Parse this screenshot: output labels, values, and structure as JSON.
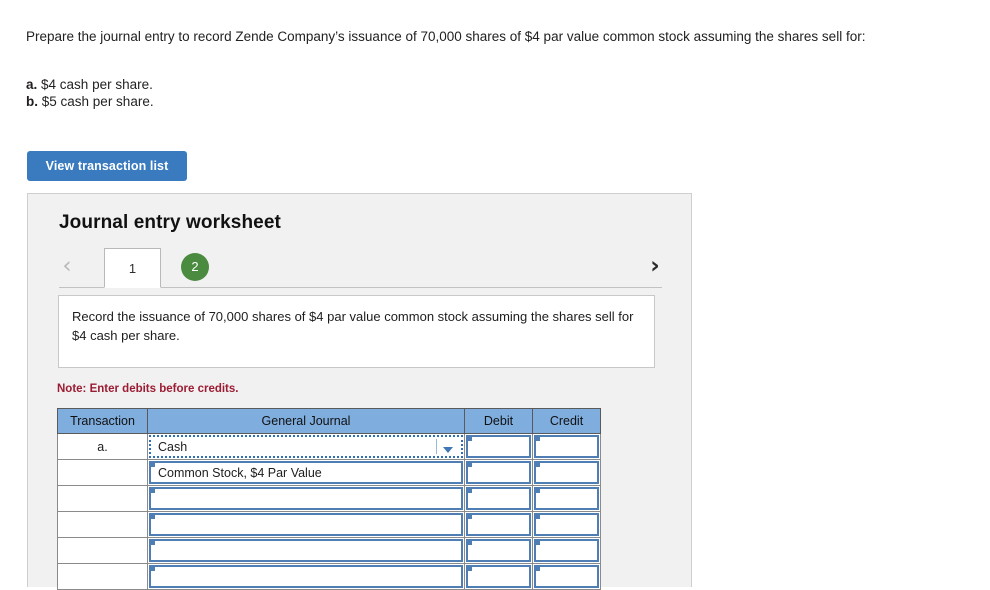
{
  "question": {
    "text": "Prepare the journal entry to record Zende Company’s issuance of 70,000 shares of $4 par value common stock assuming the shares sell for:",
    "choices": [
      {
        "label": "a.",
        "text": "$4 cash per share."
      },
      {
        "label": "b.",
        "text": "$5 cash per share."
      }
    ]
  },
  "toolbar": {
    "view_transaction_list_label": "View transaction list"
  },
  "worksheet": {
    "title": "Journal entry worksheet",
    "prev_arrow": "‹",
    "next_arrow": "›",
    "tabs": [
      {
        "label": "1",
        "state": "active"
      },
      {
        "label": "2",
        "state": "completed"
      }
    ],
    "instruction": "Record the issuance of 70,000 shares of $4 par value common stock assuming the shares sell for $4 cash per share.",
    "note": "Note: Enter debits before credits.",
    "table": {
      "columns": [
        "Transaction",
        "General Journal",
        "Debit",
        "Credit"
      ],
      "rows": [
        {
          "transaction": "a.",
          "general_journal": "Cash",
          "debit": "",
          "credit": "",
          "selected": true,
          "dropdown": true
        },
        {
          "transaction": "",
          "general_journal": "Common Stock, $4 Par Value",
          "debit": "",
          "credit": "",
          "selected": false,
          "dropdown": false
        },
        {
          "transaction": "",
          "general_journal": "",
          "debit": "",
          "credit": "",
          "selected": false,
          "dropdown": false
        },
        {
          "transaction": "",
          "general_journal": "",
          "debit": "",
          "credit": "",
          "selected": false,
          "dropdown": false
        },
        {
          "transaction": "",
          "general_journal": "",
          "debit": "",
          "credit": "",
          "selected": false,
          "dropdown": false
        },
        {
          "transaction": "",
          "general_journal": "",
          "debit": "",
          "credit": "",
          "selected": false,
          "dropdown": false
        }
      ]
    }
  },
  "colors": {
    "button_blue": "#3a7bbf",
    "header_blue": "#7fadde",
    "tab_green": "#4a8b3f",
    "note_red": "#9b1c33",
    "cell_border_blue": "#4e7eb4",
    "panel_gray": "#f1f1f1"
  }
}
